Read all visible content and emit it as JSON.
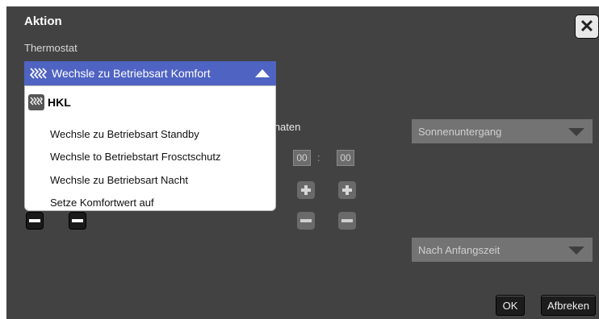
{
  "dialog": {
    "title": "Aktion",
    "subtitle": "Thermostat"
  },
  "action_select": {
    "selected": "Wechsle zu Betriebsart Komfort",
    "icon": "heating-icon",
    "menu": {
      "group_label": "HKL",
      "items": [
        "Wechsle zu Betriebsart Standby",
        "Wechsle to Betriebstart Frosctschutz",
        "Wechsle zu Betriebsart Nacht",
        "Setze Komfortwert auf"
      ]
    }
  },
  "background": {
    "coords_fragment": "linaten",
    "time": {
      "hours": "00",
      "minutes": "00",
      "separator": ":"
    }
  },
  "dropdowns": {
    "sun_event": "Sonnenuntergang",
    "time_mode": "Nach Anfangszeit"
  },
  "buttons": {
    "ok": "OK",
    "cancel": "Afbreken"
  },
  "colors": {
    "accent": "#4f63c3",
    "dialog_bg": "#424242"
  }
}
